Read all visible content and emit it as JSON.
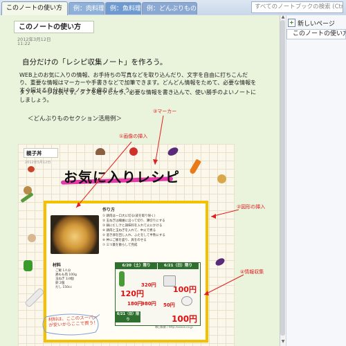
{
  "tabs": [
    {
      "label": "このノートの使い方",
      "active": true
    },
    {
      "label": "例：肉料理",
      "active": false
    },
    {
      "label": "例：魚料理",
      "active": false
    },
    {
      "label": "例：どんぶりもの",
      "active": false
    }
  ],
  "search": {
    "placeholder": "すべてのノートブックの検索 (Ctrl+E)"
  },
  "right_pane": {
    "new_page_label": "新しいページ",
    "pages": [
      "このノートの使い方"
    ]
  },
  "page": {
    "title": "このノートの使い方",
    "date": "2012年3月12日",
    "time": "11:22",
    "heading": "自分だけの「レシピ収集ノート」を作ろう。",
    "paragraph1": "WEB上のお気に入りの情報、お手持ちの写真などを取り込んだり、文字を自由に打ちこんだり、重要な情報はマーカーや手書きなどで加筆できます。どんどん情報をためて、必要な情報をすぐ探せる自分だけのノートを作りましょう。",
    "paragraph2": "タブやページは例です。タブを増やしたり、必要な情報を書き込んで、使い勝手のよいノートにしましょう。",
    "section_title": "＜どんぶりものセクション活用例＞"
  },
  "annotations": {
    "marker": "③マーカー",
    "image": "①画像の挿入",
    "shape": "②図形の挿入",
    "info": "④情報収集"
  },
  "recipe": {
    "name": "親子丼",
    "date": "2012年5月12日",
    "title": "お気に入りレシピ",
    "howto_label": "作り方",
    "howto_lines": [
      "① 鶏肉は一口大に切る(皮を取り除く)",
      "② 玉ねぎは繊維に沿って切り、薄切りにする",
      "③ 鍋にだし汁と調味料を入れて火にかける",
      "④ 鶏肉と玉ねぎを入れて、中火で煮る",
      "⑤ 溶き卵を回し入れ、ふたをして半熟にする",
      "⑥ 丼にご飯を盛り、具をのせる",
      "⑦ 三つ葉を散らして完成"
    ],
    "ingredients_label": "材料",
    "ingredients": [
      "ご飯 1人分",
      "鶏もも肉 100g",
      "玉ねぎ 1/4個",
      "卵 2個",
      "だし 150cc"
    ],
    "flyer": {
      "header1": "6/20（土）限り",
      "header2": "6/21（日）限り",
      "header3": "6/21（日）限り",
      "prices": [
        "120円",
        "320円",
        "180円",
        "980円",
        "100円",
        "50円",
        "100円"
      ],
      "caption": "毎日新鮮 / http://xxxxx.co.jp"
    },
    "bubble_text": "材料は、ここのスーパーが安いからここで買う！"
  },
  "colors": {
    "accent": "#e02020",
    "highlight": "#e53aa8",
    "frame": "#f5c000",
    "page_bg": "#eaf3dc"
  }
}
